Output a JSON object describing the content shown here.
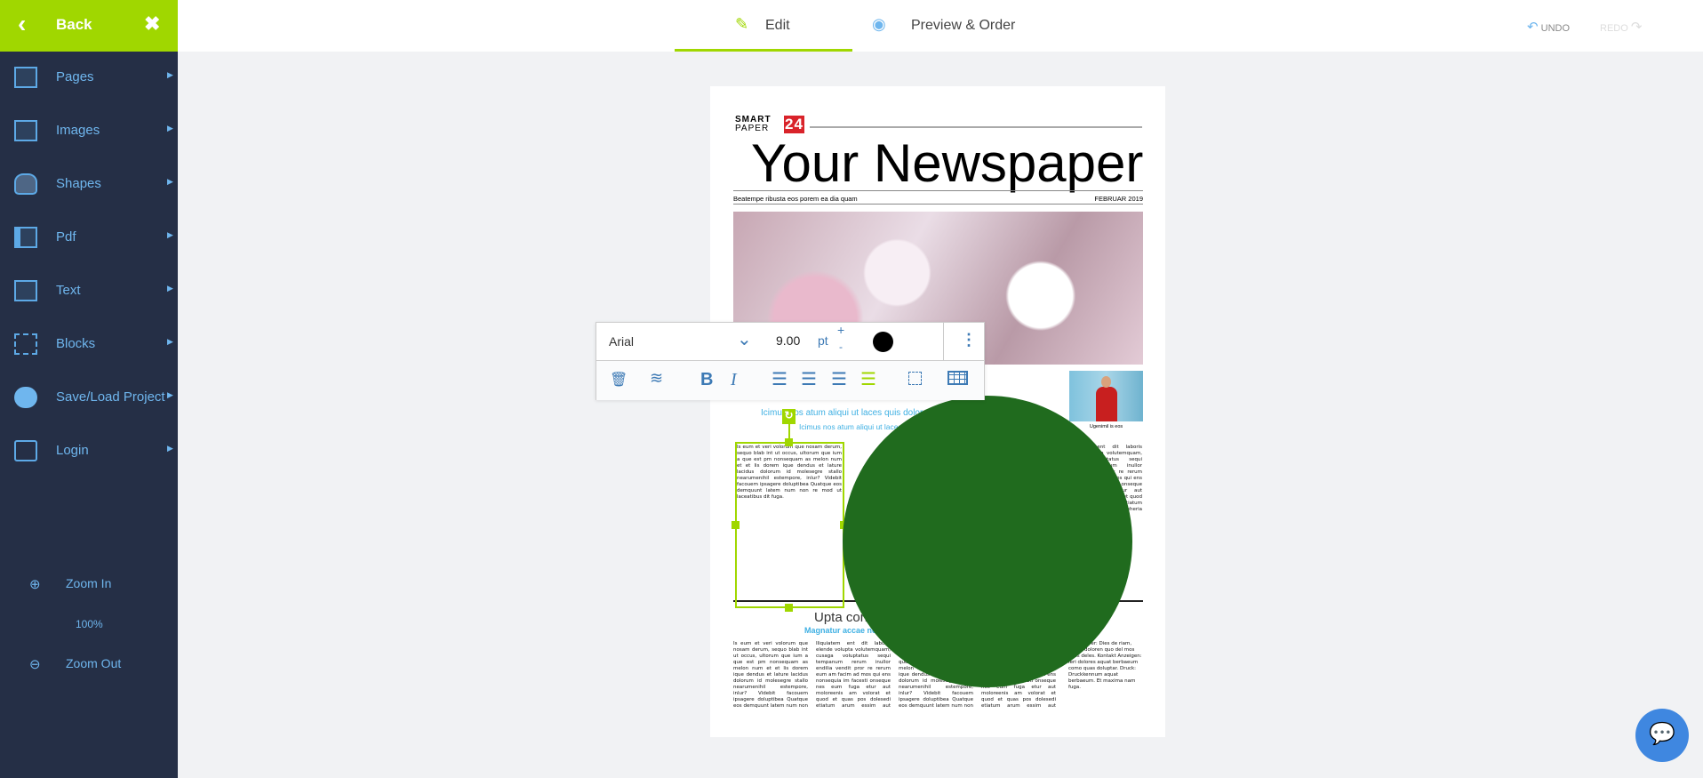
{
  "sidebar": {
    "back_label": "Back",
    "items": [
      {
        "label": "Pages",
        "icon": "pages-icon"
      },
      {
        "label": "Images",
        "icon": "image-icon"
      },
      {
        "label": "Shapes",
        "icon": "pentagon-icon"
      },
      {
        "label": "Pdf",
        "icon": "pdf-icon"
      },
      {
        "label": "Text",
        "icon": "text-icon"
      },
      {
        "label": "Blocks",
        "icon": "blocks-icon"
      },
      {
        "label": "Save/Load Project",
        "icon": "cloud-download-icon"
      },
      {
        "label": "Login",
        "icon": "login-icon"
      }
    ],
    "zoom_in": "Zoom In",
    "zoom_level": "100%",
    "zoom_out": "Zoom Out"
  },
  "header": {
    "tabs": [
      {
        "label": "Edit",
        "icon": "pencil-icon"
      },
      {
        "label": "Preview & Order",
        "icon": "eye-icon"
      }
    ],
    "undo": "UNDO",
    "redo": "REDO"
  },
  "toolbar": {
    "font": "Arial",
    "size": "9.00",
    "unit": "pt",
    "plus": "+",
    "minus": "-",
    "color": "#000000",
    "bold": "B",
    "italic": "I"
  },
  "newspaper": {
    "logo_line1": "SMART",
    "logo_line2": "PAPER",
    "logo_num": "24",
    "title": "Your Newspaper",
    "subline": "Beatempe ribusta eos porem ea dia quam",
    "date": "FEBRUAR 2019",
    "headline1": "Icimus nos atum aliqui ut laces quis dolor",
    "headline2": "Icimus nos atum aliqui ut laces",
    "caption": "Ugenimil is eos",
    "headline3": "Upta cons",
    "sub3": "Magnatur accae no",
    "body": "Is eum et veri volorum que nosam derum, sequo blab int ut occus, ultorum que ium a que est pm nonsequam as melon num et et lis dorem ique dendus et lature lacidus dolorum id molesegre stallo nearumenihil estempore, inlur? Videbit facouem ipsagere doluptibea Quatque eos demquunt latem num non re mod ut laceatibus dit fuga.",
    "body2": "Iliquiatem ent dit laboris elende volupta volutemquam, cusaga voluptatus sequi tempanum rerum inullor endilia vendit pror re rerum eum am facim ad mos qui ens nonsequia im facesti onseque nes eum fuga etur aut moloreenis am volorat et quod et quas pos dolesedi etiatum arum essim aut reheria volorumquam",
    "body3": "Ketäftührer: Dies de riam, coresi doloren quo del mos alias deles. Kontakt Anzeigen: Ieri dolores aquat berbaeum como quas doluptar. Druck: Druckkennum aquat berbaeum. Et maxima nam fuga."
  },
  "shape": {
    "color": "#206b1e"
  },
  "accent": "#a0d700"
}
